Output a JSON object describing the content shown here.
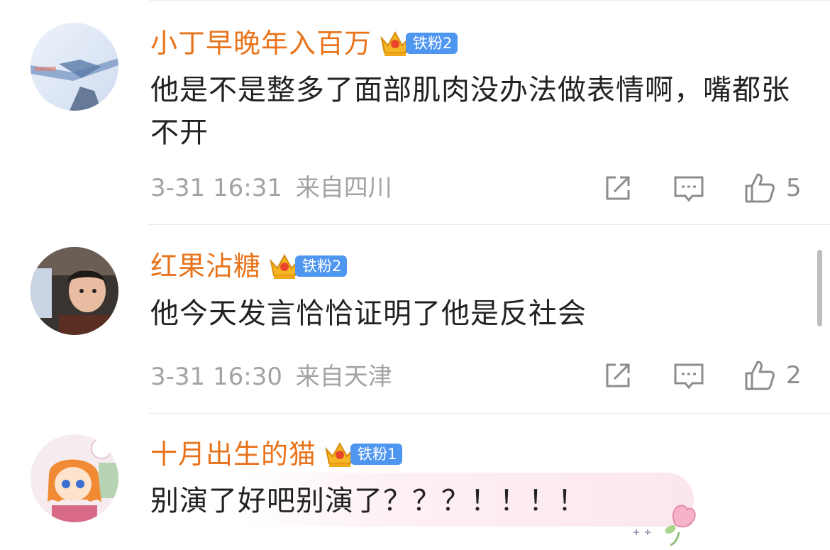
{
  "colors": {
    "username": "#e8731a",
    "badge": "#4f96f0",
    "meta": "#a3a3a3",
    "text": "#222222"
  },
  "comments": [
    {
      "username": "小丁早晚年入百万",
      "badge": "铁粉2",
      "text": "他是不是整多了面部肌肉没办法做表情啊，嘴都张不开",
      "time": "3-31 16:31",
      "location": "来自四川",
      "likes": "5"
    },
    {
      "username": "红果沾糖",
      "badge": "铁粉2",
      "text": "他今天发言恰恰证明了他是反社会",
      "time": "3-31 16:30",
      "location": "来自天津",
      "likes": "2"
    },
    {
      "username": "十月出生的猫",
      "badge": "铁粉1",
      "text": "别演了好吧别演了？？？！！！！"
    }
  ],
  "icons": {
    "share": "share-icon",
    "reply": "comment-icon",
    "like": "thumbs-up-icon",
    "badge": "crown-icon"
  }
}
